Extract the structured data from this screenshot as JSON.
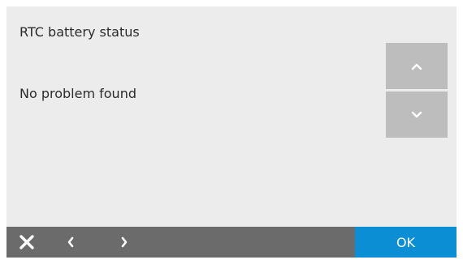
{
  "dialog": {
    "title": "RTC battery status",
    "message": "No problem found"
  },
  "scroll": {
    "up_icon": "chevron-up-icon",
    "down_icon": "chevron-down-icon"
  },
  "footer": {
    "close_icon": "close-icon",
    "back_icon": "chevron-left-icon",
    "forward_icon": "chevron-right-icon",
    "ok_label": "OK"
  },
  "colors": {
    "panel_background": "#ececec",
    "scroll_button": "#bdbdbd",
    "bottom_bar": "#6b6b6b",
    "ok_button": "#0c8ed4",
    "text": "#2b2b2b"
  }
}
